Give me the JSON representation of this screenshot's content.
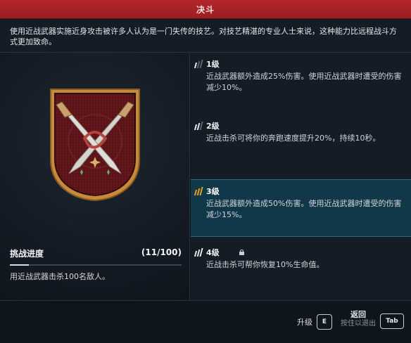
{
  "header": {
    "title": "决斗"
  },
  "description": "使用近战武器实施近身攻击被许多人认为是一门失传的技艺。对技艺精湛的专业人士来说，这种能力比远程战斗方式更加致命。",
  "badge": {
    "icon": "crossed-blades-badge-icon",
    "colors": {
      "frame": "#c58a3a",
      "field": "#5a1418",
      "blade": "#d6d2cc",
      "hilt": "#b5433c"
    }
  },
  "challenge": {
    "title": "挑战进度",
    "count": "(11/100)",
    "progress": 0.11,
    "text": "用近战武器击杀100名敌人。"
  },
  "levels": [
    {
      "label": "1级",
      "text": "近战武器额外造成25%伤害。使用近战武器时遭受的伤害减少10%。",
      "tier": 1,
      "active": false,
      "locked": false
    },
    {
      "label": "2级",
      "text": "近战击杀可将你的奔跑速度提升20%，持续10秒。",
      "tier": 2,
      "active": false,
      "locked": false
    },
    {
      "label": "3级",
      "text": "近战武器额外造成50%伤害。使用近战武器时遭受的伤害减少15%。",
      "tier": 3,
      "active": true,
      "locked": false
    },
    {
      "label": "4级",
      "text": "近战击杀可帮你恢复10%生命值。",
      "tier": 4,
      "active": false,
      "locked": true
    }
  ],
  "footer": {
    "upgrade_label": "升级",
    "upgrade_key": "E",
    "back_label": "返回",
    "back_hint": "按住以退出",
    "back_key": "Tab"
  },
  "colors": {
    "title_bar": "#a62024",
    "active_row": "#103848"
  }
}
